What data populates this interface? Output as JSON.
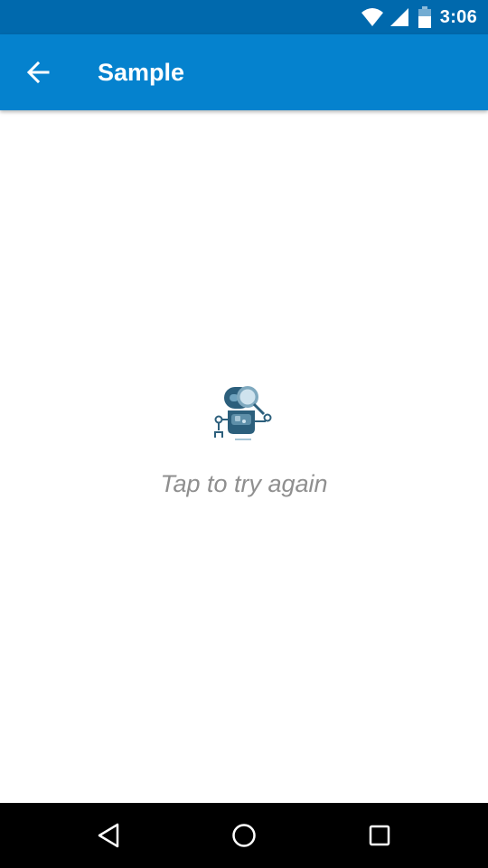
{
  "status_bar": {
    "time": "3:06",
    "icons": [
      "wifi-icon",
      "signal-icon",
      "battery-icon"
    ],
    "background": "#0069ad"
  },
  "app_bar": {
    "title": "Sample",
    "back_icon": "arrow-back-icon",
    "background": "#0582ce"
  },
  "empty_state": {
    "illustration": "robot-magnifier-icon",
    "message": "Tap to try again",
    "message_color": "#8f8f8f"
  },
  "nav_bar": {
    "buttons": [
      "triangle-back-icon",
      "circle-home-icon",
      "square-recents-icon"
    ],
    "background": "#000000"
  }
}
